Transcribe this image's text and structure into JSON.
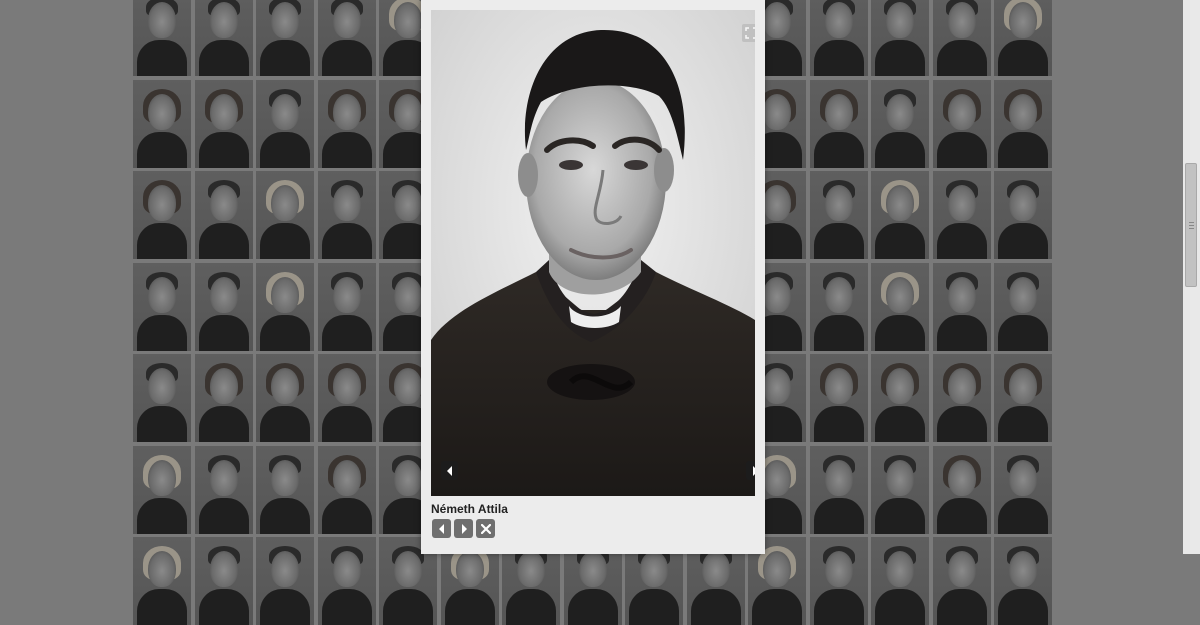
{
  "lightbox": {
    "caption": "Németh Attila",
    "expand_icon": "expand-icon",
    "prev_icon": "arrow-left-icon",
    "next_icon": "arrow-right-icon",
    "controls": [
      {
        "name": "prev-button",
        "icon": "arrow-left-icon"
      },
      {
        "name": "next-button",
        "icon": "arrow-right-icon"
      },
      {
        "name": "close-button",
        "icon": "close-icon"
      }
    ]
  },
  "colors": {
    "backdrop": "#7a7a7a",
    "lightbox_bg": "#ececec",
    "control_bg": "#6f6f6f"
  }
}
